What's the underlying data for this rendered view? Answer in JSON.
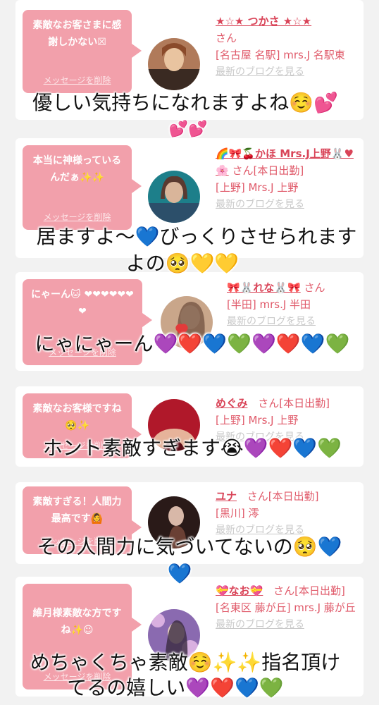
{
  "cards": [
    {
      "message": "素敵なお客さまに感謝しかない☒",
      "delete_label": "メッセージを削除",
      "name": "★☆★ つかさ ★☆★",
      "suffix": "さん",
      "location": "[名古屋 名駅] mrs.J 名駅東",
      "blog_label": "最新のブログを見る",
      "avatar_icon": "woman-photo-avatar",
      "avatar_colors": [
        "#b07a5a",
        "#3a2a22",
        "#e9c4a0"
      ]
    },
    {
      "message": "本当に神様っているんだぁ✨✨",
      "delete_label": "メッセージを削除",
      "name": "🌈🎀🍒かほ Mrs.J上野🐰♥🌸",
      "suffix": "さん[本日出勤]",
      "location": "[上野] Mrs.J 上野",
      "blog_label": "最新のブログを見る",
      "avatar_icon": "woman-photo-avatar",
      "avatar_colors": [
        "#1d7f8a",
        "#2c4f6a",
        "#d9b59a"
      ]
    },
    {
      "message": "にゃーん🐱 ❤❤❤❤❤❤❤",
      "delete_label": "メッセージを削除",
      "name": "🎀🐰れな🐰🎀",
      "suffix": "さん",
      "location": "[半田] mrs.J 半田",
      "blog_label": "最新のブログを見る",
      "avatar_icon": "woman-photo-avatar",
      "avatar_colors": [
        "#c9a68a",
        "#6b4c3b",
        "#e23a3a"
      ]
    },
    {
      "message": "素敵なお客様ですね🥺✨",
      "delete_label": "メッセージを削除",
      "name": "めぐみ",
      "suffix": "さん[本日出勤]",
      "location": "[上野] Mrs.J 上野",
      "blog_label": "最新のブログを見る",
      "avatar_icon": "woman-photo-avatar",
      "avatar_colors": [
        "#b0182a",
        "#5a0a14",
        "#e6b39a"
      ]
    },
    {
      "message": "素敵すぎる！人間力最高です🙆",
      "delete_label": "メッセージを削除",
      "name": "ユナ",
      "suffix": "さん[本日出勤]",
      "location": "[黒川] 澪",
      "blog_label": "最新のブログを見る",
      "avatar_icon": "woman-photo-avatar",
      "avatar_colors": [
        "#2a1a18",
        "#6a4034",
        "#d8b8a8"
      ]
    },
    {
      "message": "維月様素敵な方ですね✨☺",
      "delete_label": "メッセージを削除",
      "name": "💝なお💝",
      "suffix": "さん[本日出勤]",
      "location": "[名東区 藤が丘] mrs.J 藤が丘",
      "blog_label": "最新のブログを見る",
      "avatar_icon": "woman-photo-avatar",
      "avatar_colors": [
        "#8a6ab0",
        "#d9b0e0",
        "#3a2a40"
      ]
    }
  ],
  "captions": [
    "優しい気持ちになれますよね☺️💕",
    "💕💕",
    "居ますよ〜💙びっくりさせられます",
    "よの🥺💛💛",
    "にゃにゃーん💜❤️💙💚💜❤️💙💚",
    "ホント素敵すぎます😭💜❤️💙💚",
    "その人間力に気づいてないの🥺💙",
    "💙",
    "めちゃくちゃ素敵☺️✨✨指名頂け",
    "てるの嬉しい💜❤️💙💚"
  ],
  "colors": {
    "page_background": "#f2f2f2",
    "card_background": "#ffffff",
    "bubble_pink": "#f2a0ab",
    "name_red": "#d94458",
    "text_pink": "#e05a6a",
    "blog_gray": "#c9c9c9"
  }
}
